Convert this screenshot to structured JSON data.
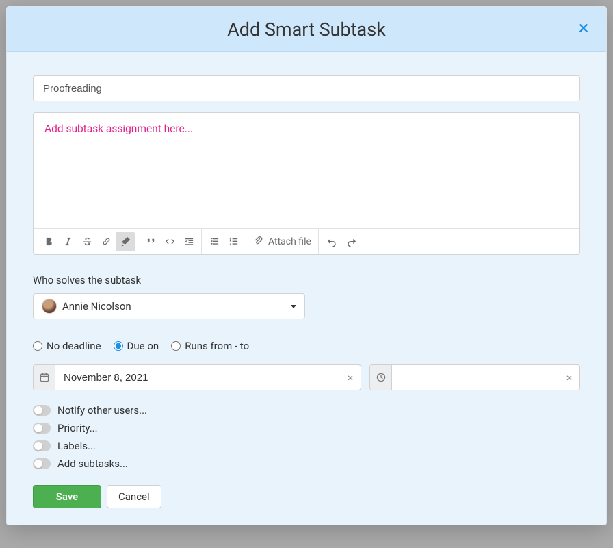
{
  "header": {
    "title": "Add Smart Subtask"
  },
  "form": {
    "title_value": "Proofreading",
    "description_placeholder": "Add subtask assignment here..."
  },
  "toolbar": {
    "attach_label": "Attach file"
  },
  "assignee": {
    "label": "Who solves the subtask",
    "name": "Annie Nicolson"
  },
  "deadline": {
    "options": {
      "none": "No deadline",
      "due": "Due on",
      "range": "Runs from - to"
    },
    "selected": "due",
    "date_value": "November 8, 2021",
    "time_value": ""
  },
  "toggles": {
    "notify": "Notify other users...",
    "priority": "Priority...",
    "labels": "Labels...",
    "subtasks": "Add subtasks..."
  },
  "actions": {
    "save": "Save",
    "cancel": "Cancel"
  }
}
